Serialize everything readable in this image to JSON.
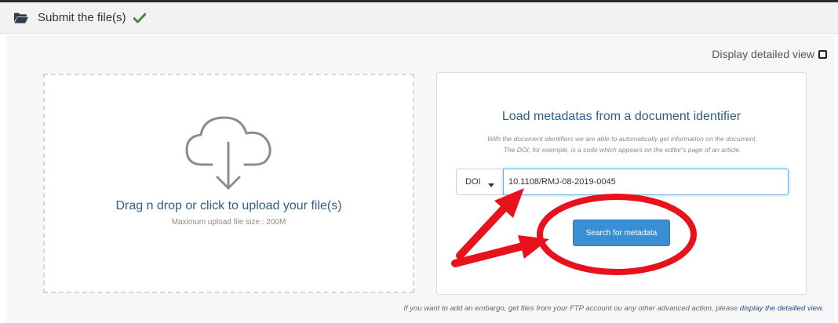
{
  "header": {
    "title": "Submit the file(s)",
    "folder_icon": "folder-open-icon",
    "check_icon": "check-icon",
    "check_color": "#3c8d3c"
  },
  "detailed_view": {
    "label": "Display detailed view",
    "checked": false
  },
  "dropzone": {
    "icon": "cloud-download-icon",
    "title": "Drag n drop or click to upload your file(s)",
    "subtitle": "Maximum upload file size : 200M"
  },
  "metadata": {
    "title": "Load metadatas from a document identifier",
    "description_line1": "With the document identifiers we are able to automatically get information on the document.",
    "description_line2": "The DOI, for exemple, is a code which appears on the editor's page of an article.",
    "id_type": "DOI",
    "id_value": "10.1108/RMJ-08-2019-0045",
    "search_label": "Search for metadata"
  },
  "footer": {
    "text": "If you want to add an embargo, get files from your FTP account ou any other advanced action, please ",
    "link": "display the detailled view."
  },
  "colors": {
    "accent_blue": "#3a8ed3",
    "title_blue": "#2f5e86",
    "annotation_red": "#e8121c"
  }
}
